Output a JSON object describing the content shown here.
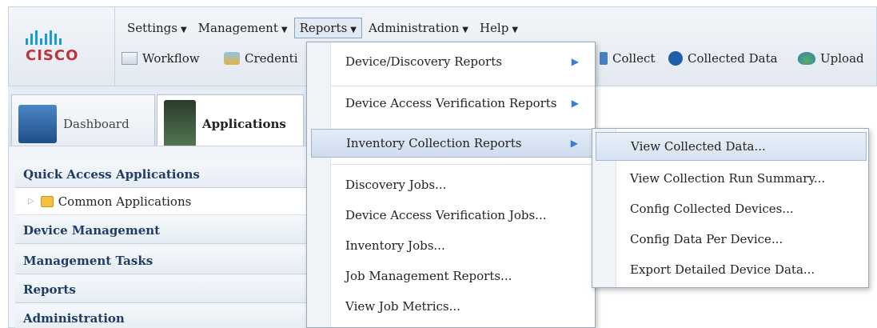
{
  "brand": {
    "logo_text": "CISCO"
  },
  "menubar": [
    {
      "label": "Settings",
      "caret": "▼"
    },
    {
      "label": "Management",
      "caret": "▼"
    },
    {
      "label": "Reports",
      "caret": "▼"
    },
    {
      "label": "Administration",
      "caret": "▼"
    },
    {
      "label": "Help",
      "caret": "▼"
    }
  ],
  "toolbar": {
    "workflow": "Workflow",
    "credentials": "Credenti",
    "collect": "Collect",
    "collected_data": "Collected Data",
    "upload": "Upload"
  },
  "tabs": {
    "dashboard": "Dashboard",
    "applications": "Applications"
  },
  "nav": {
    "quick_access": "Quick Access Applications",
    "common_apps": "Common Applications",
    "device_mgmt": "Device Management",
    "mgmt_tasks": "Management Tasks",
    "reports": "Reports",
    "administration": "Administration"
  },
  "reports_menu": {
    "device_discovery": "Device/Discovery Reports",
    "device_access": "Device Access Verification Reports",
    "inventory_collection": "Inventory Collection Reports",
    "discovery_jobs": "Discovery Jobs...",
    "dav_jobs": "Device Access Verification Jobs...",
    "inventory_jobs": "Inventory Jobs...",
    "job_mgmt": "Job Management Reports...",
    "job_metrics": "View Job Metrics..."
  },
  "submenu": {
    "view_collected": "View Collected Data...",
    "run_summary": "View Collection Run Summary...",
    "config_devices": "Config Collected Devices...",
    "config_per_device": "Config Data Per Device...",
    "export": "Export Detailed Device Data..."
  },
  "icons": {
    "arrow": "▶",
    "tree_collapsed": "▷"
  }
}
